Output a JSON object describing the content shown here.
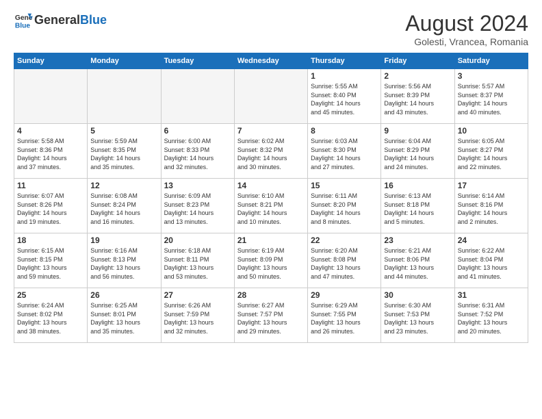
{
  "header": {
    "logo_line1": "General",
    "logo_line2": "Blue",
    "month_year": "August 2024",
    "location": "Golesti, Vrancea, Romania"
  },
  "days_of_week": [
    "Sunday",
    "Monday",
    "Tuesday",
    "Wednesday",
    "Thursday",
    "Friday",
    "Saturday"
  ],
  "weeks": [
    [
      {
        "day": "",
        "detail": ""
      },
      {
        "day": "",
        "detail": ""
      },
      {
        "day": "",
        "detail": ""
      },
      {
        "day": "",
        "detail": ""
      },
      {
        "day": "1",
        "detail": "Sunrise: 5:55 AM\nSunset: 8:40 PM\nDaylight: 14 hours\nand 45 minutes."
      },
      {
        "day": "2",
        "detail": "Sunrise: 5:56 AM\nSunset: 8:39 PM\nDaylight: 14 hours\nand 43 minutes."
      },
      {
        "day": "3",
        "detail": "Sunrise: 5:57 AM\nSunset: 8:37 PM\nDaylight: 14 hours\nand 40 minutes."
      }
    ],
    [
      {
        "day": "4",
        "detail": "Sunrise: 5:58 AM\nSunset: 8:36 PM\nDaylight: 14 hours\nand 37 minutes."
      },
      {
        "day": "5",
        "detail": "Sunrise: 5:59 AM\nSunset: 8:35 PM\nDaylight: 14 hours\nand 35 minutes."
      },
      {
        "day": "6",
        "detail": "Sunrise: 6:00 AM\nSunset: 8:33 PM\nDaylight: 14 hours\nand 32 minutes."
      },
      {
        "day": "7",
        "detail": "Sunrise: 6:02 AM\nSunset: 8:32 PM\nDaylight: 14 hours\nand 30 minutes."
      },
      {
        "day": "8",
        "detail": "Sunrise: 6:03 AM\nSunset: 8:30 PM\nDaylight: 14 hours\nand 27 minutes."
      },
      {
        "day": "9",
        "detail": "Sunrise: 6:04 AM\nSunset: 8:29 PM\nDaylight: 14 hours\nand 24 minutes."
      },
      {
        "day": "10",
        "detail": "Sunrise: 6:05 AM\nSunset: 8:27 PM\nDaylight: 14 hours\nand 22 minutes."
      }
    ],
    [
      {
        "day": "11",
        "detail": "Sunrise: 6:07 AM\nSunset: 8:26 PM\nDaylight: 14 hours\nand 19 minutes."
      },
      {
        "day": "12",
        "detail": "Sunrise: 6:08 AM\nSunset: 8:24 PM\nDaylight: 14 hours\nand 16 minutes."
      },
      {
        "day": "13",
        "detail": "Sunrise: 6:09 AM\nSunset: 8:23 PM\nDaylight: 14 hours\nand 13 minutes."
      },
      {
        "day": "14",
        "detail": "Sunrise: 6:10 AM\nSunset: 8:21 PM\nDaylight: 14 hours\nand 10 minutes."
      },
      {
        "day": "15",
        "detail": "Sunrise: 6:11 AM\nSunset: 8:20 PM\nDaylight: 14 hours\nand 8 minutes."
      },
      {
        "day": "16",
        "detail": "Sunrise: 6:13 AM\nSunset: 8:18 PM\nDaylight: 14 hours\nand 5 minutes."
      },
      {
        "day": "17",
        "detail": "Sunrise: 6:14 AM\nSunset: 8:16 PM\nDaylight: 14 hours\nand 2 minutes."
      }
    ],
    [
      {
        "day": "18",
        "detail": "Sunrise: 6:15 AM\nSunset: 8:15 PM\nDaylight: 13 hours\nand 59 minutes."
      },
      {
        "day": "19",
        "detail": "Sunrise: 6:16 AM\nSunset: 8:13 PM\nDaylight: 13 hours\nand 56 minutes."
      },
      {
        "day": "20",
        "detail": "Sunrise: 6:18 AM\nSunset: 8:11 PM\nDaylight: 13 hours\nand 53 minutes."
      },
      {
        "day": "21",
        "detail": "Sunrise: 6:19 AM\nSunset: 8:09 PM\nDaylight: 13 hours\nand 50 minutes."
      },
      {
        "day": "22",
        "detail": "Sunrise: 6:20 AM\nSunset: 8:08 PM\nDaylight: 13 hours\nand 47 minutes."
      },
      {
        "day": "23",
        "detail": "Sunrise: 6:21 AM\nSunset: 8:06 PM\nDaylight: 13 hours\nand 44 minutes."
      },
      {
        "day": "24",
        "detail": "Sunrise: 6:22 AM\nSunset: 8:04 PM\nDaylight: 13 hours\nand 41 minutes."
      }
    ],
    [
      {
        "day": "25",
        "detail": "Sunrise: 6:24 AM\nSunset: 8:02 PM\nDaylight: 13 hours\nand 38 minutes."
      },
      {
        "day": "26",
        "detail": "Sunrise: 6:25 AM\nSunset: 8:01 PM\nDaylight: 13 hours\nand 35 minutes."
      },
      {
        "day": "27",
        "detail": "Sunrise: 6:26 AM\nSunset: 7:59 PM\nDaylight: 13 hours\nand 32 minutes."
      },
      {
        "day": "28",
        "detail": "Sunrise: 6:27 AM\nSunset: 7:57 PM\nDaylight: 13 hours\nand 29 minutes."
      },
      {
        "day": "29",
        "detail": "Sunrise: 6:29 AM\nSunset: 7:55 PM\nDaylight: 13 hours\nand 26 minutes."
      },
      {
        "day": "30",
        "detail": "Sunrise: 6:30 AM\nSunset: 7:53 PM\nDaylight: 13 hours\nand 23 minutes."
      },
      {
        "day": "31",
        "detail": "Sunrise: 6:31 AM\nSunset: 7:52 PM\nDaylight: 13 hours\nand 20 minutes."
      }
    ]
  ]
}
